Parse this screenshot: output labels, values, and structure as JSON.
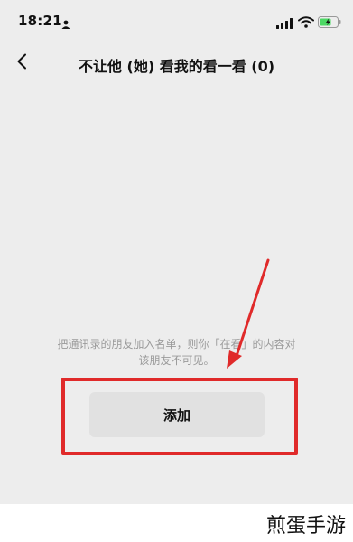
{
  "status_bar": {
    "time": "18:21",
    "icons": [
      "person-icon",
      "signal-icon",
      "wifi-icon",
      "battery-icon"
    ],
    "battery_color": "#4cd964"
  },
  "nav": {
    "back_icon": "chevron-left-icon",
    "title": "不让他 (她) 看我的看一看 (0)"
  },
  "hint": {
    "line1": "把通讯录的朋友加入名单，则你「在看」的内容对",
    "line2": "该朋友不可见。"
  },
  "add_button": {
    "label": "添加"
  },
  "annotation": {
    "color": "#e02a2a"
  },
  "watermark": {
    "text": "煎蛋手游"
  },
  "colors": {
    "background": "#ededed",
    "button_bg": "#e1e1e1",
    "hint_text": "#9a9a9a"
  }
}
